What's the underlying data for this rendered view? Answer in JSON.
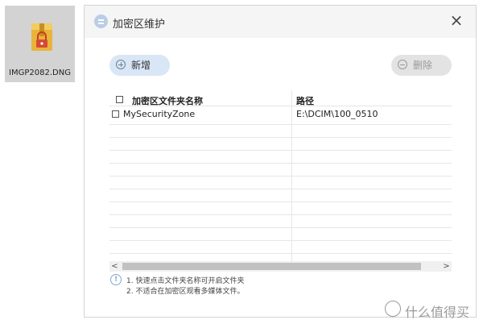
{
  "desktop": {
    "file": {
      "name": "IMGP2082.DNG",
      "icon": "locked-folder-icon"
    }
  },
  "dialog": {
    "title": "加密区维护",
    "close_label": "×",
    "toolbar": {
      "add_label": "新增",
      "delete_label": "删除"
    },
    "table": {
      "columns": [
        "加密区文件夹名称",
        "路径"
      ],
      "rows": [
        {
          "name": "MySecurityZone",
          "path": "E:\\DCIM\\100_0510"
        }
      ]
    },
    "scrollbar": {
      "left_arrow": "<",
      "right_arrow": ">"
    },
    "notes": [
      "1. 快速点击文件夹名称可开启文件夹",
      "2. 不适合在加密区观看多媒体文件。"
    ]
  },
  "watermark": {
    "text": "什么值得买"
  },
  "colors": {
    "add_button_bg": "#d9e6f6",
    "delete_button_bg": "#e3e3e3",
    "header_bg": "#f5f5f5",
    "info_accent": "#7fa6d4"
  }
}
